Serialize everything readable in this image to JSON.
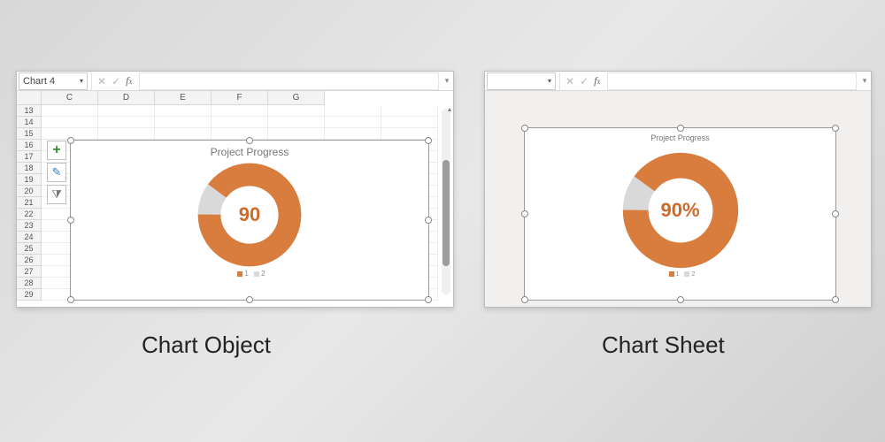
{
  "captions": {
    "left": "Chart Object",
    "right": "Chart Sheet"
  },
  "left_panel": {
    "namebox": "Chart 4",
    "columns": [
      "C",
      "D",
      "E",
      "F",
      "G"
    ],
    "rows": [
      "13",
      "14",
      "15",
      "16",
      "17",
      "18",
      "19",
      "20",
      "21",
      "22",
      "23",
      "24",
      "25",
      "26",
      "27",
      "28",
      "29"
    ],
    "chart": {
      "title": "Project Progress",
      "center_label": "90",
      "legend": [
        "1",
        "2"
      ]
    },
    "tools": {
      "plus": "+",
      "brush": "✎",
      "funnel": "⧩"
    }
  },
  "right_panel": {
    "chart": {
      "title": "Project Progress",
      "center_label": "90%",
      "legend": [
        "1",
        "2"
      ]
    }
  },
  "chart_data": [
    {
      "type": "pie",
      "subtype": "donut",
      "title": "Project Progress",
      "series": [
        {
          "name": "1",
          "value": 90
        },
        {
          "name": "2",
          "value": 10
        }
      ],
      "colors": [
        "#d87d3e",
        "#d9d9d9"
      ],
      "center_text": "90",
      "hole_ratio": 0.5
    },
    {
      "type": "pie",
      "subtype": "donut",
      "title": "Project Progress",
      "series": [
        {
          "name": "1",
          "value": 90
        },
        {
          "name": "2",
          "value": 10
        }
      ],
      "colors": [
        "#d87d3e",
        "#d9d9d9"
      ],
      "center_text": "90%",
      "hole_ratio": 0.5
    }
  ]
}
